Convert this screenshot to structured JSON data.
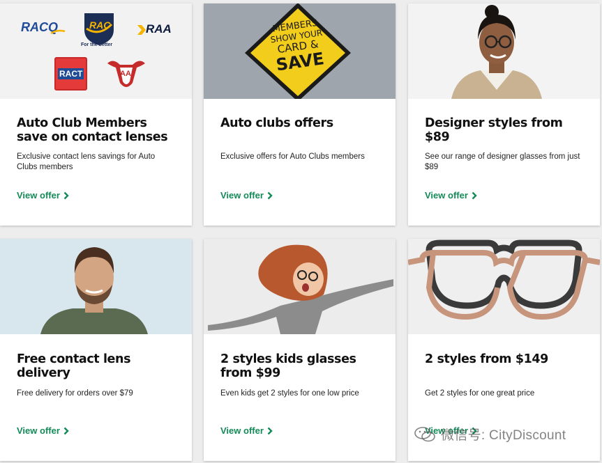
{
  "brand": {
    "accent": "#138a57"
  },
  "offers": [
    {
      "title": "Auto Club Members save on contact lenses",
      "description": "Exclusive contact lens savings for Auto Clubs members",
      "link": "View offer",
      "logos": {
        "racq": "RACQ",
        "rac": "RAC",
        "rac_tag": "For the better",
        "raa": "RAA",
        "ract": "RACT",
        "aant": "AA"
      }
    },
    {
      "title": "Auto clubs offers",
      "description": "Exclusive offers for Auto Clubs members",
      "link": "View offer",
      "sign": [
        "MEMBERS",
        "SHOW YOUR",
        "CARD &",
        "SAVE"
      ]
    },
    {
      "title": "Designer styles from $89",
      "description": "See our range of designer glasses from just $89",
      "link": "View offer"
    },
    {
      "title": "Free contact lens delivery",
      "description": "Free delivery for orders over $79",
      "link": "View offer"
    },
    {
      "title": "2 styles kids glasses from $99",
      "description": "Even kids get 2 styles for one low price",
      "link": "View offer"
    },
    {
      "title": "2 styles from $149",
      "description": "Get 2 styles for one great price",
      "link": "View offer"
    }
  ],
  "watermark": "微信号: CityDiscount"
}
